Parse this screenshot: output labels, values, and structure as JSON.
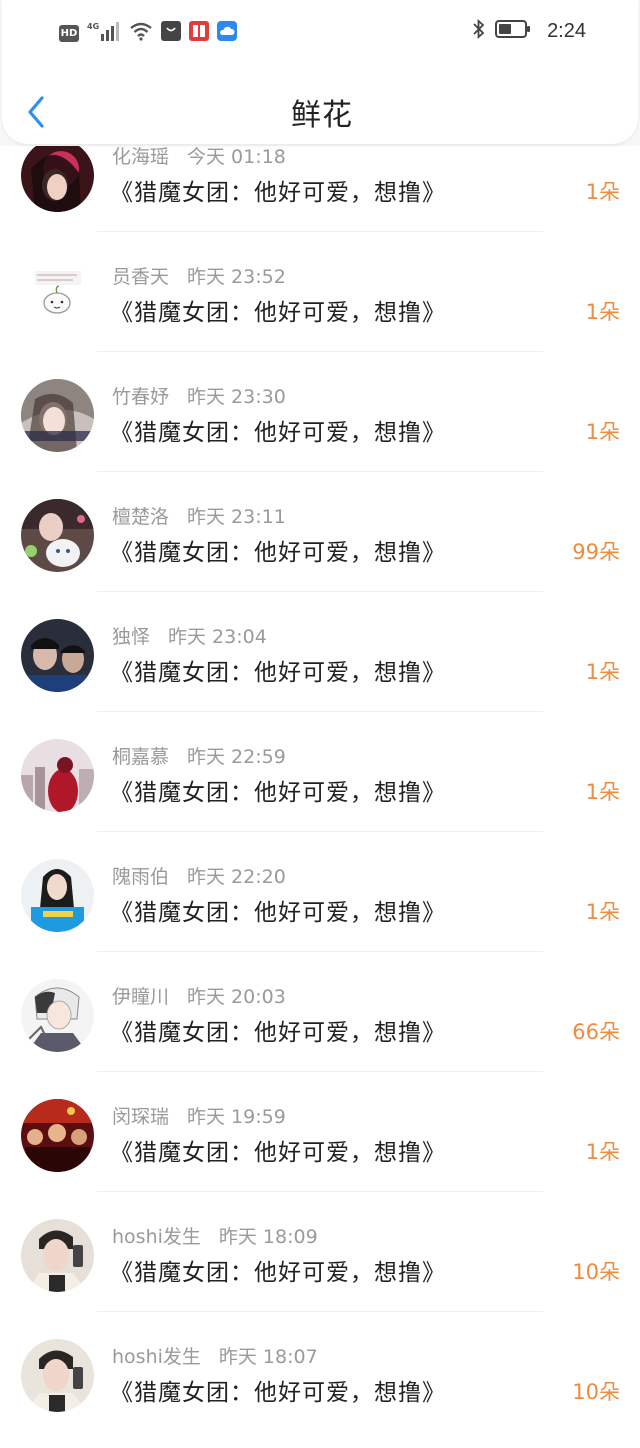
{
  "status_bar": {
    "hd": "HD",
    "network": "4G",
    "time": "2:24"
  },
  "header": {
    "title": "鲜花"
  },
  "items": [
    {
      "name": "化海瑶",
      "time": "今天 01:18",
      "message": "《猎魔女团：他好可爱，想撸》",
      "count": "1朵"
    },
    {
      "name": "员香天",
      "time": "昨天 23:52",
      "message": "《猎魔女团：他好可爱，想撸》",
      "count": "1朵"
    },
    {
      "name": "竹春妤",
      "time": "昨天 23:30",
      "message": "《猎魔女团：他好可爱，想撸》",
      "count": "1朵"
    },
    {
      "name": "檀楚洛",
      "time": "昨天 23:11",
      "message": "《猎魔女团：他好可爱，想撸》",
      "count": "99朵"
    },
    {
      "name": "独怿",
      "time": "昨天 23:04",
      "message": "《猎魔女团：他好可爱，想撸》",
      "count": "1朵"
    },
    {
      "name": "桐嘉慕",
      "time": "昨天 22:59",
      "message": "《猎魔女团：他好可爱，想撸》",
      "count": "1朵"
    },
    {
      "name": "隗雨伯",
      "time": "昨天 22:20",
      "message": "《猎魔女团：他好可爱，想撸》",
      "count": "1朵"
    },
    {
      "name": "伊瞳川",
      "time": "昨天 20:03",
      "message": "《猎魔女团：他好可爱，想撸》",
      "count": "66朵"
    },
    {
      "name": "闵琛瑞",
      "time": "昨天 19:59",
      "message": "《猎魔女团：他好可爱，想撸》",
      "count": "1朵"
    },
    {
      "name": "hoshi发生",
      "time": "昨天 18:09",
      "message": "《猎魔女团：他好可爱，想撸》",
      "count": "10朵"
    },
    {
      "name": "hoshi发生",
      "time": "昨天 18:07",
      "message": "《猎魔女团：他好可爱，想撸》",
      "count": "10朵"
    }
  ],
  "colors": {
    "accent_back": "#2b8ff0",
    "count": "#f08a3c",
    "meta": "#9a9a9a",
    "text": "#222222"
  }
}
